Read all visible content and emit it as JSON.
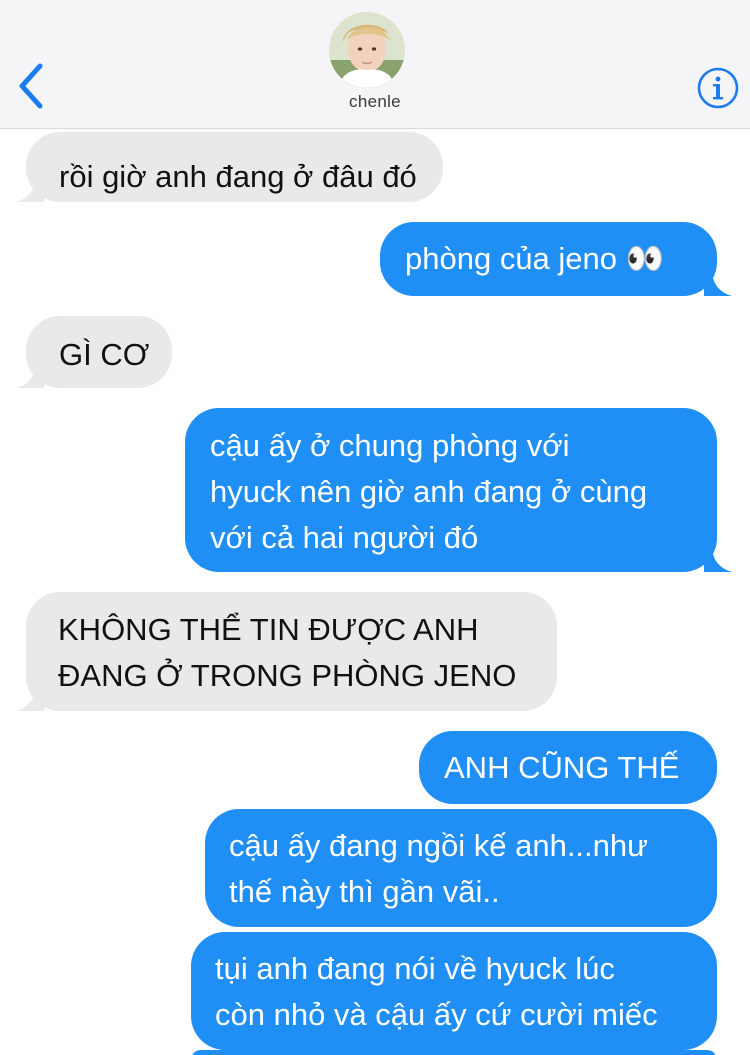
{
  "header": {
    "contact_name": "chenle",
    "back_icon": "chevron-left-icon",
    "info_icon": "info-icon",
    "accent_color": "#1a7cf0"
  },
  "messages": [
    {
      "from": "contact",
      "text": "rồi giờ anh đang ở đâu đó"
    },
    {
      "from": "me",
      "text": "phòng của jeno 👀"
    },
    {
      "from": "contact",
      "text": "GÌ CƠ"
    },
    {
      "from": "me",
      "lines": [
        "cậu ấy ở chung phòng với",
        "hyuck nên giờ anh đang ở cùng",
        "với cả hai người đó"
      ]
    },
    {
      "from": "contact",
      "lines": [
        "KHÔNG THỂ TIN ĐƯỢC ANH",
        "ĐANG Ở TRONG PHÒNG JENO"
      ]
    },
    {
      "from": "me",
      "text": "ANH CŨNG THẾ"
    },
    {
      "from": "me",
      "lines": [
        "cậu ấy đang ngồi kế anh...như",
        "thế này thì gần vãi.."
      ]
    },
    {
      "from": "me",
      "lines": [
        "tụi anh đang nói về hyuck lúc",
        "còn nhỏ và cậu ấy cứ cười miếc"
      ]
    }
  ],
  "colors": {
    "sent_bubble": "#1f8ef5",
    "received_bubble": "#e9e9eb",
    "header_background": "#f5f5f7"
  }
}
